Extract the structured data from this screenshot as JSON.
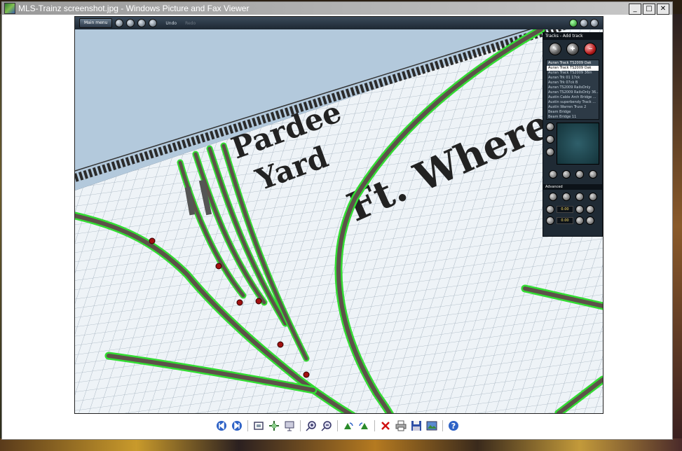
{
  "window": {
    "title": "MLS-Trainz screenshot.jpg - Windows Picture and Fax Viewer",
    "minimize_label": "_",
    "maximize_label": "□",
    "close_label": "✕"
  },
  "game": {
    "toolbar": {
      "main_menu_label": "Main menu",
      "undo_label": "Undo",
      "redo_label": "Redo"
    },
    "scene_labels": {
      "yard_line1": "Pardee",
      "yard_line2": "Yard",
      "town": "Ft. Whereami"
    },
    "panel": {
      "title": "Tracks - Add track",
      "list_header": "Auran Track TS2009 Oak",
      "items": [
        "Auran Track TS2009 Oak",
        "Auran Track TS2009 36in",
        "Auran Trk 01 17ck",
        "Auran Trk 07ck B",
        "Auran TS2009 RailsOnly",
        "Auran TS2009 RailsOnly 36...",
        "Austin Cable Arch Bridge ...",
        "Austin superbendy Track ...",
        "Austin Warren Truss 2",
        "Beam Bridge",
        "Beam Bridge 11"
      ],
      "advanced_label": "Advanced",
      "value1": "0.00",
      "value2": "0.00"
    }
  },
  "colors": {
    "sky": "#b3c9dc",
    "grid_bg": "#eef3f7",
    "grid_line": "#9aaab8",
    "track_fill": "#5d514a",
    "track_highlight": "#33dd33"
  },
  "toolbar_icons": [
    "previous-image-icon",
    "next-image-icon",
    "best-fit-icon",
    "actual-size-icon",
    "slideshow-icon",
    "zoom-in-icon",
    "zoom-out-icon",
    "rotate-clockwise-icon",
    "rotate-counterclockwise-icon",
    "delete-icon",
    "print-icon",
    "save-icon",
    "open-editor-icon",
    "help-icon"
  ]
}
